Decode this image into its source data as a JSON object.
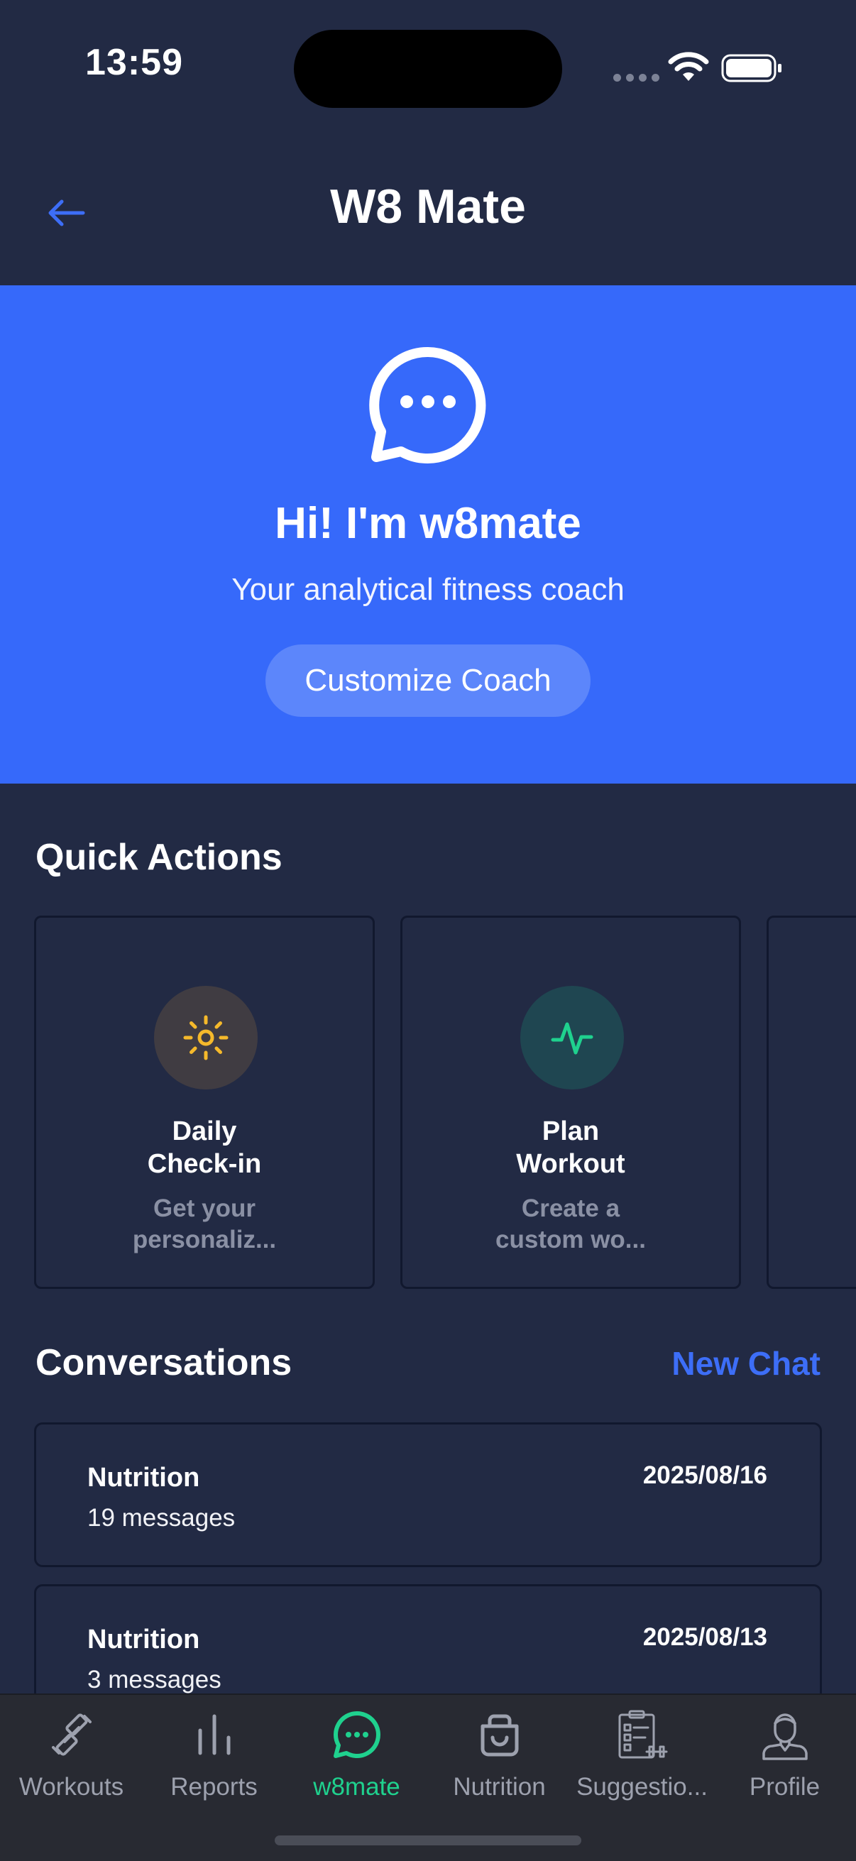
{
  "status_bar": {
    "time": "13:59"
  },
  "header": {
    "title": "W8 Mate"
  },
  "hero": {
    "title": "Hi! I'm w8mate",
    "subtitle": "Your analytical fitness coach",
    "customize_label": "Customize Coach"
  },
  "quick_actions": {
    "title": "Quick Actions",
    "items": [
      {
        "title_line1": "Daily",
        "title_line2": "Check-in",
        "desc_line1": "Get your",
        "desc_line2": "personaliz...",
        "icon": "sun-icon",
        "accent": "#f5b92b",
        "icon_bg": "#403c42"
      },
      {
        "title_line1": "Plan",
        "title_line2": "Workout",
        "desc_line1": "Create a",
        "desc_line2": "custom wo...",
        "icon": "activity-icon",
        "accent": "#1fd18e",
        "icon_bg": "#1f4651"
      }
    ]
  },
  "conversations": {
    "title": "Conversations",
    "new_chat_label": "New Chat",
    "items": [
      {
        "title": "Nutrition",
        "count": "19 messages",
        "date": "2025/08/16"
      },
      {
        "title": "Nutrition",
        "count": "3 messages",
        "date": "2025/08/13"
      }
    ]
  },
  "tabs": [
    {
      "label": "Workouts",
      "icon": "dumbbell-icon"
    },
    {
      "label": "Reports",
      "icon": "bar-chart-icon"
    },
    {
      "label": "w8mate",
      "icon": "chat-bubble-icon",
      "active": true
    },
    {
      "label": "Nutrition",
      "icon": "basket-icon"
    },
    {
      "label": "Suggestio...",
      "icon": "clipboard-dumbbell-icon"
    },
    {
      "label": "Profile",
      "icon": "person-icon"
    }
  ],
  "colors": {
    "background": "#222a44",
    "hero": "#3669fa",
    "accent_blue": "#3d6ef7",
    "active_tab": "#1fd18e",
    "tab_bar": "#282a32"
  }
}
